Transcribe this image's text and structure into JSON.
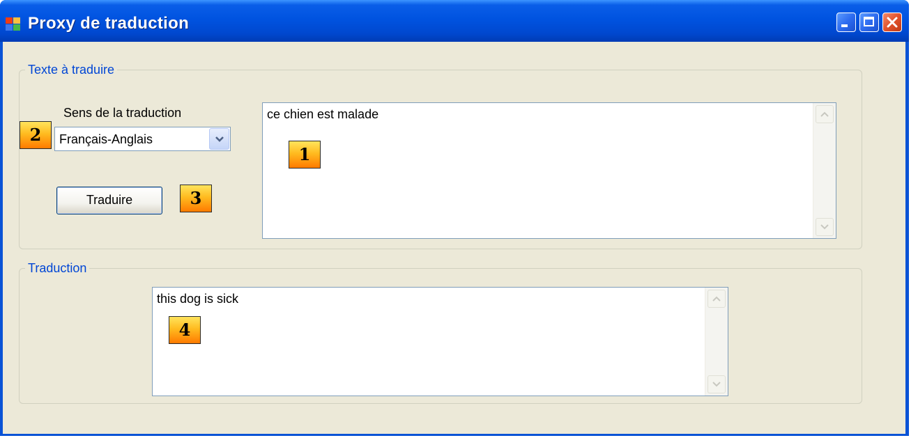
{
  "window": {
    "title": "Proxy de traduction",
    "icon": "app-window-icon",
    "controls": [
      "minimize-icon",
      "maximize-icon",
      "close-icon"
    ]
  },
  "input_group": {
    "legend": "Texte à traduire",
    "direction_label": "Sens de la traduction",
    "direction_value": "Français-Anglais",
    "translate_button": "Traduire",
    "source_text": "ce chien est malade"
  },
  "output_group": {
    "legend": "Traduction",
    "translated_text": "this dog is sick"
  },
  "markers": {
    "m1": "1",
    "m2": "2",
    "m3": "3",
    "m4": "4"
  },
  "colors": {
    "titlebar": "#0054e3",
    "client": "#ece9d8",
    "legend": "#0046d5",
    "marker": "#ffb020",
    "close_button": "#e2522c"
  }
}
